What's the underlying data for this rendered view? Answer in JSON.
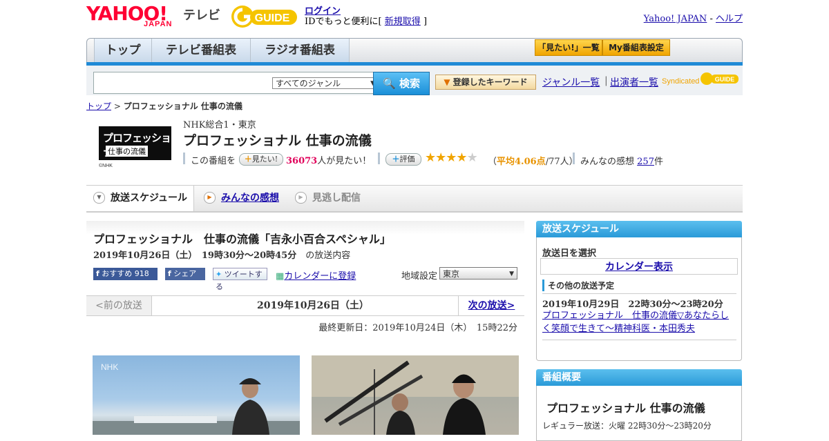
{
  "header": {
    "logo_yahoo": "YAHOO!",
    "logo_japan": "JAPAN",
    "logo_tv": "テレビ",
    "guide_logo": "GUIDE",
    "login_label": "ログイン",
    "login_sub_prefix": "IDでもっと便利に[",
    "signup_label": "新規取得",
    "login_sub_suffix": "]",
    "yahoo_japan_link": "Yahoo! JAPAN",
    "link_sep": "-",
    "help_link": "ヘルプ"
  },
  "nav": {
    "tabs": [
      "トップ",
      "テレビ番組表",
      "ラジオ番組表"
    ],
    "mitai_list": "「見たい!」一覧",
    "my_bangumi": "My番組表設定"
  },
  "search": {
    "query": "",
    "genre_selected": "すべてのジャンル",
    "button_label": "検索",
    "keyword_button": "登録したキーワード",
    "genre_list_link": "ジャンル一覧",
    "separator": "|",
    "cast_list_link": "出演者一覧",
    "syndicated": "Syndicated"
  },
  "breadcrumb": {
    "top": "トップ",
    "sep": ">",
    "current": "プロフェッショナル 仕事の流儀"
  },
  "program": {
    "thumb_line1": "プロフェッショナル",
    "thumb_line2": "仕事の流儀",
    "thumb_credit": "©NHK",
    "station": "NHK総合1・東京",
    "title": "プロフェッショナル 仕事の流儀",
    "mitai_prefix": "この番組を",
    "mitai_button": "見たい!",
    "mitai_count": "36073",
    "mitai_suffix": "人が見たい！",
    "eval_button": "評価",
    "rating": 4.06,
    "avg_label": "平均4.06点",
    "avg_count": "/77人）",
    "impressions_label": "みんなの感想",
    "impressions_count": "257",
    "impressions_unit": "件"
  },
  "tabs": {
    "schedule": "放送スケジュール",
    "impressions": "みんなの感想",
    "missed": "見逃し配信"
  },
  "episode": {
    "title": "プロフェッショナル　仕事の流儀「吉永小百合スペシャル」",
    "datetime": "2019年10月26日（土）　19時30分～20時45分",
    "datetime_suffix": "の放送内容",
    "fb_recommend": "おすすめ 918",
    "fb_share": "シェア",
    "tweet": "ツイートする",
    "calendar_link": "カレンダーに登録",
    "region_label": "地域設定",
    "region_value": "東京",
    "prev_label": "<前の放送",
    "current_date": "2019年10月26日（土）",
    "next_label": "次の放送>",
    "updated": "最終更新日：2019年10月24日（木）　15時22分",
    "image_watermark": "NHK"
  },
  "sidebar": {
    "schedule_head": "放送スケジュール",
    "pick_date": "放送日を選択",
    "calendar_button": "カレンダー表示",
    "other_label": "その他の放送予定",
    "other_date": "2019年10月29日　22時30分～23時20分",
    "other_link": "プロフェッショナル　仕事の流儀▽あなたらしく笑顔で生きて～精神科医・本田秀夫",
    "overview_head": "番組概要",
    "overview_title": "プロフェッショナル 仕事の流儀",
    "overview_regular": "レギュラー放送：火曜 22時30分～23時20分"
  },
  "colors": {
    "yahoo_red": "#ff0033",
    "accent_blue": "#1f8ad6",
    "star_gold": "#f0a400",
    "count_pink": "#e0005a"
  }
}
